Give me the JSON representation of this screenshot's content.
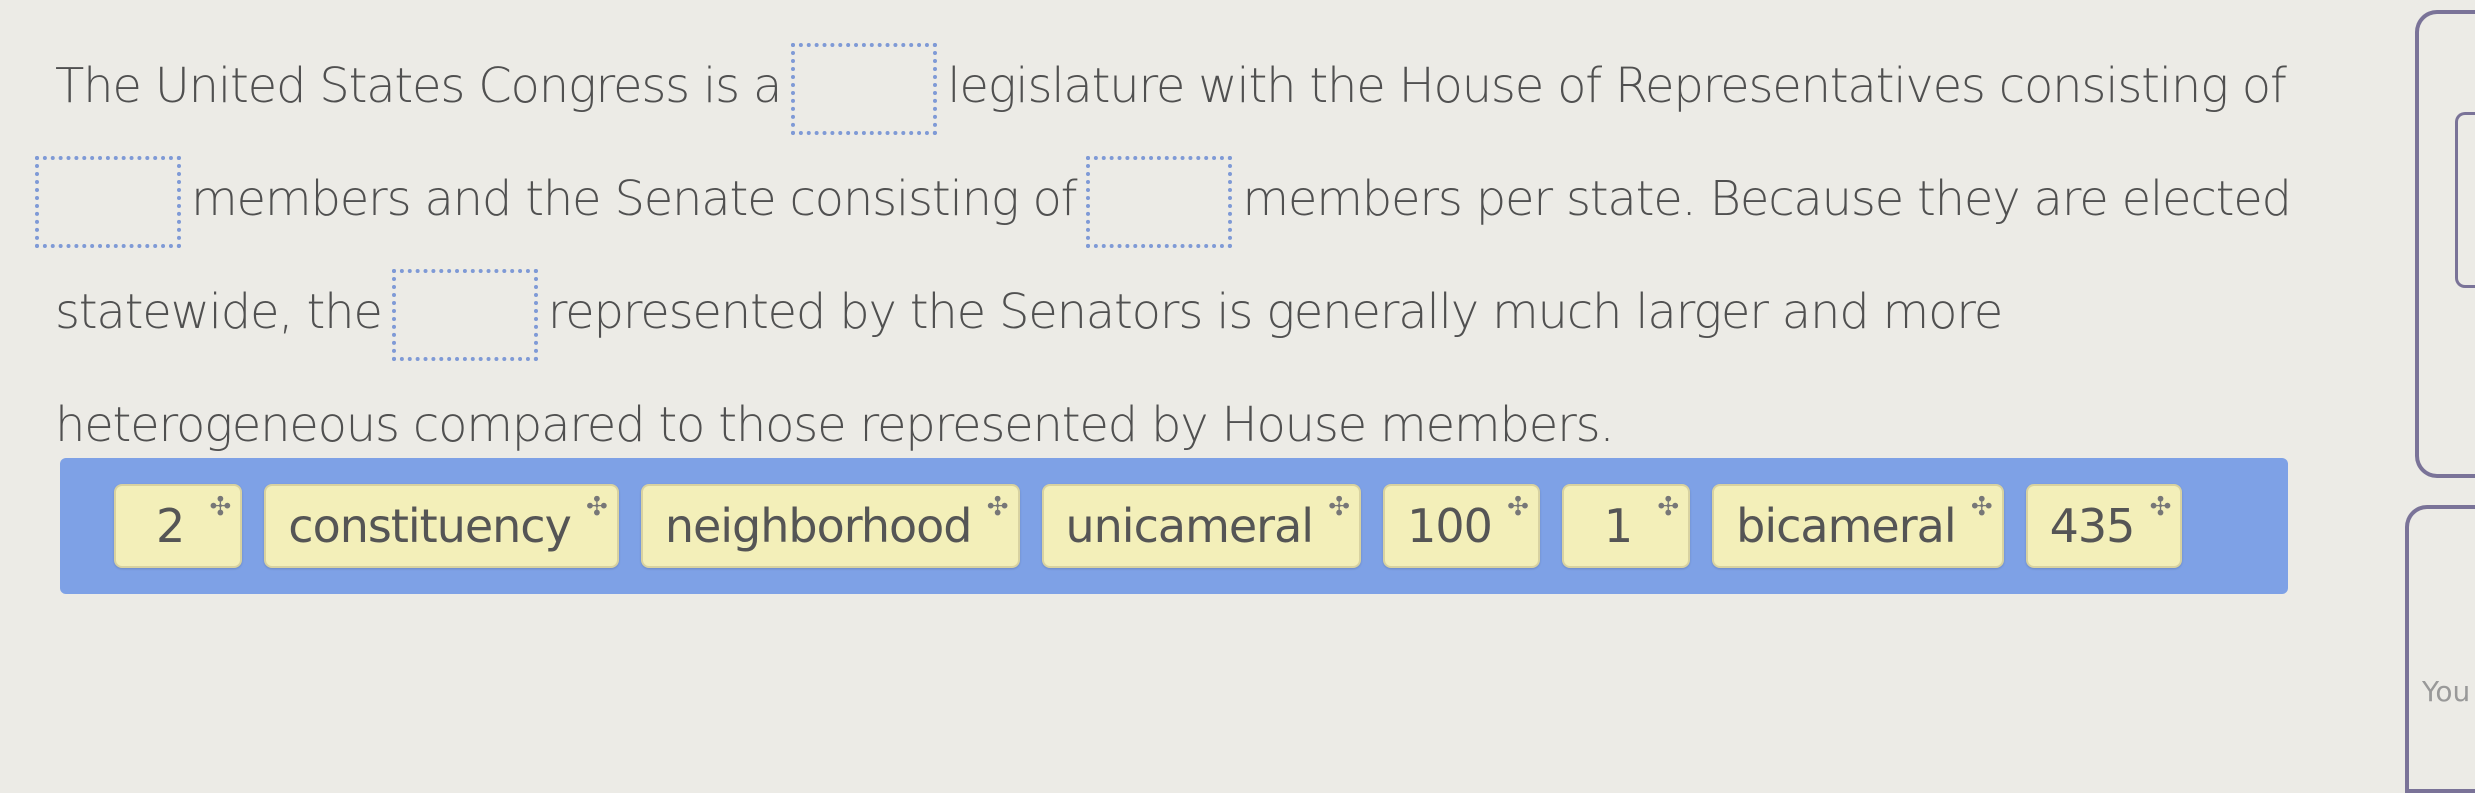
{
  "passage": {
    "part1": "The United States Congress is a",
    "part2": "legislature with the House of Representatives consisting of",
    "part3": "members and the Senate consisting of",
    "part4": "members per state. Because they are elected statewide, the",
    "part5": "represented by the Senators is generally much larger and more heterogeneous compared to those represented by House members."
  },
  "blanks": [
    "",
    "",
    "",
    ""
  ],
  "answer_chips": [
    {
      "label": "2",
      "icon": "move-icon"
    },
    {
      "label": "constituency",
      "icon": "move-icon"
    },
    {
      "label": "neighborhood",
      "icon": "move-icon"
    },
    {
      "label": "unicameral",
      "icon": "move-icon"
    },
    {
      "label": "100",
      "icon": "move-icon"
    },
    {
      "label": "1",
      "icon": "move-icon"
    },
    {
      "label": "bicameral",
      "icon": "move-icon"
    },
    {
      "label": "435",
      "icon": "move-icon"
    }
  ],
  "move_glyph": "✣",
  "side_panel": {
    "label": "You"
  }
}
